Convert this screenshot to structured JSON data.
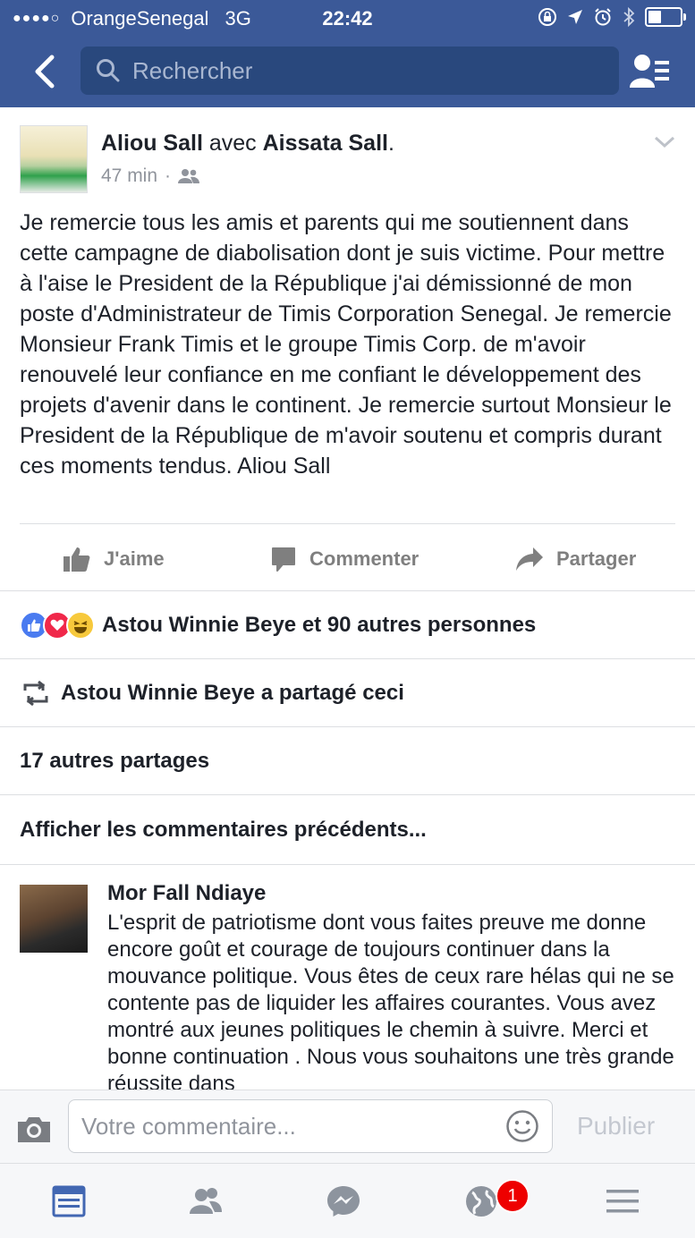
{
  "status": {
    "carrier": "OrangeSenegal",
    "network": "3G",
    "time": "22:42"
  },
  "search": {
    "placeholder": "Rechercher"
  },
  "post": {
    "author": "Aliou Sall",
    "with_word": "avec",
    "tagged": "Aissata Sall",
    "time": "47 min",
    "text": "Je remercie tous les amis et parents qui me soutiennent dans cette campagne de diabolisation dont je suis victime. Pour mettre à l'aise le President de la République j'ai démissionné de mon poste d'Administrateur de Timis Corporation Senegal. Je remercie Monsieur Frank Timis et le groupe Timis Corp. de m'avoir renouvelé leur confiance en me confiant le développement des projets d'avenir dans le continent. Je remercie surtout Monsieur le President de la République de m'avoir soutenu et compris durant ces moments tendus. Aliou Sall",
    "actions": {
      "like": "J'aime",
      "comment": "Commenter",
      "share": "Partager"
    }
  },
  "reactions_text": "Astou Winnie Beye et 90 autres personnes",
  "shared_text": "Astou Winnie Beye a partagé ceci",
  "other_shares": "17 autres partages",
  "show_previous": "Afficher les commentaires précédents...",
  "comment": {
    "author": "Mor Fall Ndiaye",
    "text": "L'esprit de patriotisme dont vous faites preuve me donne encore goût et courage de toujours continuer dans la mouvance politique. Vous êtes de ceux rare hélas qui ne se contente pas de liquider les affaires courantes. Vous avez montré aux jeunes politiques le chemin à suivre. Merci et bonne continuation . Nous vous souhaitons une très grande réussite dans"
  },
  "composer": {
    "placeholder": "Votre commentaire...",
    "publish": "Publier"
  },
  "tabbar": {
    "notifications_badge": "1"
  },
  "colors": {
    "brand": "#3b5998",
    "search_bg": "#29487d",
    "active_tab": "#4267b2",
    "badge": "#e00000"
  }
}
